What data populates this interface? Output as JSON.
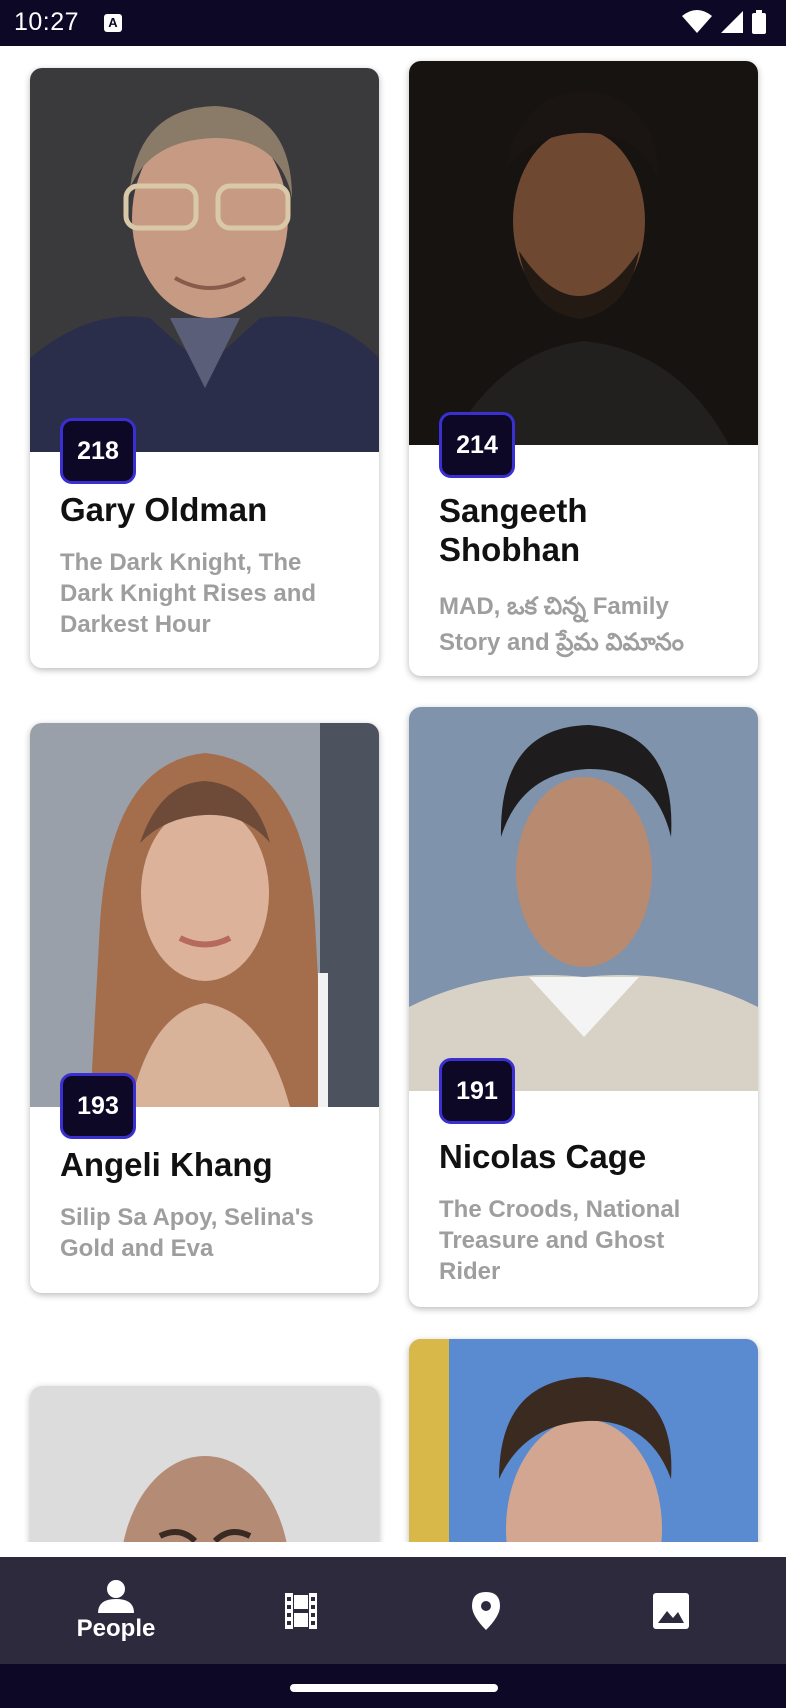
{
  "status_bar": {
    "time": "10:27",
    "notification_icon": "a-notification-icon",
    "icons": [
      "wifi-icon",
      "signal-icon",
      "battery-icon"
    ]
  },
  "people": [
    {
      "rank": "218",
      "name": "Gary Oldman",
      "credits": "The Dark Knight, The Dark Knight Rises and Darkest Hour"
    },
    {
      "rank": "214",
      "name": "Sangeeth Shobhan",
      "credits": "MAD, ఒక చిన్న Family Story and ప్రేమ విమానం"
    },
    {
      "rank": "193",
      "name": "Angeli Khang",
      "credits": "Silip Sa Apoy, Selina's Gold and Eva"
    },
    {
      "rank": "191",
      "name": "Nicolas Cage",
      "credits": "The Croods, National Treasure and Ghost Rider"
    }
  ],
  "bottom_nav": {
    "items": [
      {
        "label": "People",
        "icon": "person-icon",
        "active": true
      },
      {
        "label": "",
        "icon": "film-icon",
        "active": false
      },
      {
        "label": "",
        "icon": "location-pin-icon",
        "active": false
      },
      {
        "label": "",
        "icon": "image-icon",
        "active": false
      }
    ]
  },
  "colors": {
    "status_bar": "#0c0825",
    "badge_bg": "#0c0825",
    "badge_border": "#3a2fd0",
    "bottom_nav": "#2d2a3e",
    "credits_text": "#9e9e9e"
  }
}
